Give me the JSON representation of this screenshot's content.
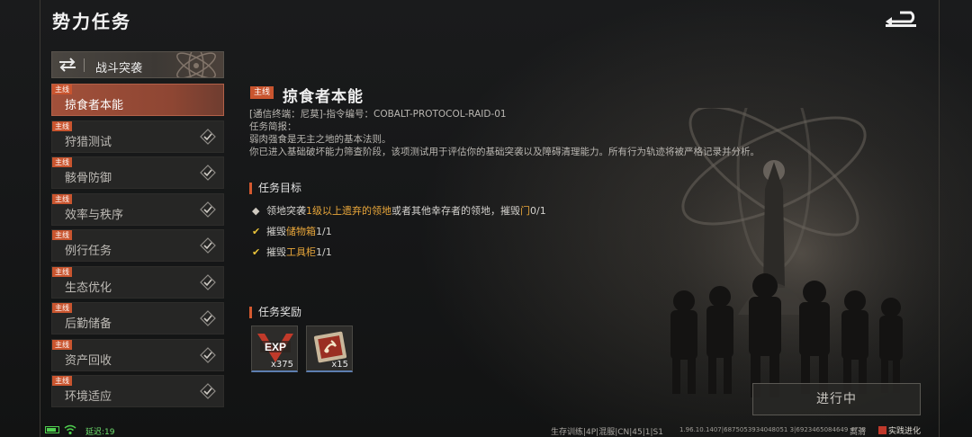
{
  "header": {
    "title": "势力任务"
  },
  "category": {
    "label": "战斗突袭"
  },
  "tasks": [
    {
      "tag": "主线",
      "label": "掠食者本能",
      "active": true,
      "done": false
    },
    {
      "tag": "主线",
      "label": "狩猎测试",
      "active": false,
      "done": true
    },
    {
      "tag": "主线",
      "label": "骸骨防御",
      "active": false,
      "done": true
    },
    {
      "tag": "主线",
      "label": "效率与秩序",
      "active": false,
      "done": true
    },
    {
      "tag": "主线",
      "label": "例行任务",
      "active": false,
      "done": true
    },
    {
      "tag": "主线",
      "label": "生态优化",
      "active": false,
      "done": true
    },
    {
      "tag": "主线",
      "label": "后勤储备",
      "active": false,
      "done": true
    },
    {
      "tag": "主线",
      "label": "资产回收",
      "active": false,
      "done": true
    },
    {
      "tag": "主线",
      "label": "环境适应",
      "active": false,
      "done": true
    }
  ],
  "detail": {
    "tag": "主线",
    "title": "掠食者本能",
    "brief_lines": [
      "[通信终端：尼莫]-指令编号：COBALT-PROTOCOL-RAID-01",
      "任务简报：",
      "弱肉强食是无主之地的基本法则。",
      "你已进入基础破坏能力筛查阶段，该项测试用于评估你的基础突袭以及障碍清理能力。所有行为轨迹将被严格记录并分析。"
    ],
    "objectives_heading": "任务目标",
    "objectives": [
      {
        "mark": "◆",
        "parts": [
          "领地突袭",
          "1级以上遗弃的领地",
          "或者其他幸存者的领地，摧毁",
          "门",
          "0/1"
        ]
      },
      {
        "mark": "✔",
        "parts": [
          "摧毁",
          "储物箱",
          "1/1"
        ]
      },
      {
        "mark": "✔",
        "parts": [
          "摧毁",
          "工具柜",
          "1/1"
        ]
      }
    ],
    "rewards_heading": "任务奖励",
    "rewards": [
      {
        "icon": "exp-icon",
        "label": "EXP",
        "count": "x375"
      },
      {
        "icon": "scorpion-badge-icon",
        "count": "x15"
      }
    ],
    "status": "进行中"
  },
  "statusbar": {
    "latency": "延迟:19",
    "server": "生存训练|4P|混服|CN|45|1|S1",
    "build": "1.96.10.1407|6875053934048051 3|6923465084649 4722",
    "quality": "高清",
    "logo": "实践进化"
  },
  "colors": {
    "accent": "#c9552f",
    "highlight": "#e8a63a",
    "active_tab": "#a1503a"
  }
}
